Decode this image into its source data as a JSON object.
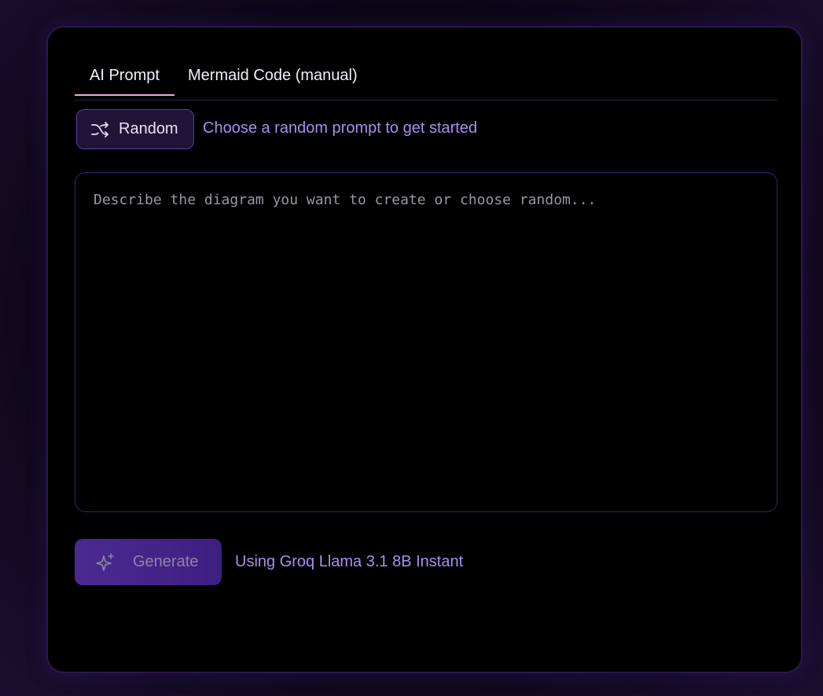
{
  "tabs": [
    {
      "label": "AI Prompt",
      "active": true
    },
    {
      "label": "Mermaid Code (manual)",
      "active": false
    }
  ],
  "random": {
    "button_label": "Random",
    "icon": "shuffle-icon",
    "hint": "Choose a random prompt to get started"
  },
  "prompt": {
    "value": "",
    "placeholder": "Describe the diagram you want to create or choose random..."
  },
  "generate": {
    "button_label": "Generate",
    "icon": "sparkles-icon",
    "model_note": "Using Groq Llama 3.1 8B Instant"
  },
  "colors": {
    "accent": "#a98ef0",
    "tab_underline": "#f0a8d8",
    "button_fill": "#4a2a90"
  }
}
